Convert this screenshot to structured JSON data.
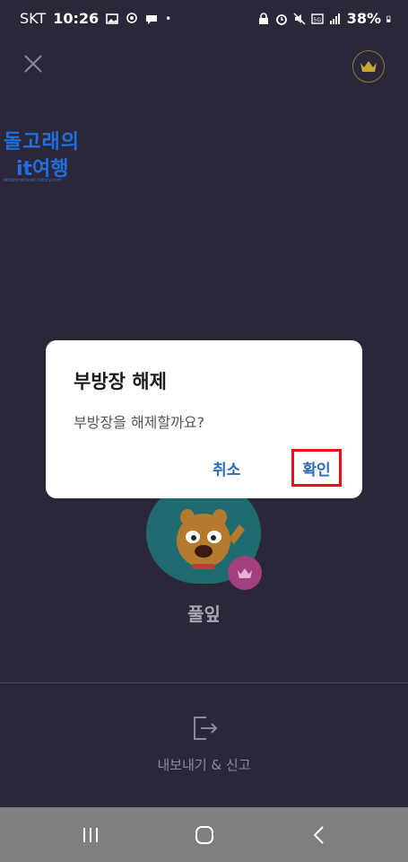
{
  "status_bar": {
    "carrier": "SKT",
    "time": "10:26",
    "dot": "•",
    "battery": "38%"
  },
  "watermark": {
    "line1": "돌고래의",
    "line2": "it여행",
    "line3": "dolphinstravel.tistory.com"
  },
  "dialog": {
    "title": "부방장 해제",
    "message": "부방장을 해제할까요?",
    "cancel_label": "취소",
    "confirm_label": "확인"
  },
  "profile": {
    "nickname": "풀잎"
  },
  "bottom_action": {
    "label": "내보내기 & 신고"
  },
  "colors": {
    "background": "#2b2739",
    "accent_button_text": "#2f6bb3",
    "highlight_box": "#e8101c",
    "crown_gold": "#c9a53a",
    "badge": "#a23f7c"
  },
  "icons": [
    "close-icon",
    "crown-icon",
    "export-icon",
    "recent-apps-icon",
    "home-icon",
    "back-icon"
  ]
}
